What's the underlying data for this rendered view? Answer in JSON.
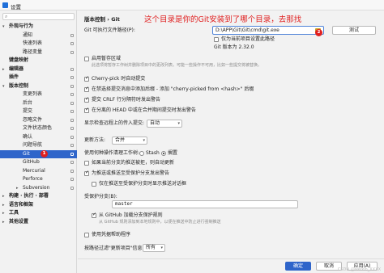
{
  "window": {
    "title": "设置"
  },
  "sidebar": {
    "items": [
      {
        "label": "外观与行为",
        "level": 0,
        "bold": true,
        "expanded": true
      },
      {
        "label": "通知",
        "level": 1
      },
      {
        "label": "快速列表",
        "level": 1
      },
      {
        "label": "路径变量",
        "level": 1
      },
      {
        "label": "键盘映射",
        "level": 0,
        "bold": true
      },
      {
        "label": "编辑器",
        "level": 0,
        "bold": true,
        "collapsed": true
      },
      {
        "label": "插件",
        "level": 0,
        "bold": true
      },
      {
        "label": "版本控制",
        "level": 0,
        "bold": true,
        "expanded": true
      },
      {
        "label": "变更列表",
        "level": 1
      },
      {
        "label": "后台",
        "level": 1
      },
      {
        "label": "提交",
        "level": 1
      },
      {
        "label": "忽略文件",
        "level": 1
      },
      {
        "label": "文件状态颜色",
        "level": 1
      },
      {
        "label": "确认",
        "level": 1
      },
      {
        "label": "问题导航",
        "level": 1
      },
      {
        "label": "Git",
        "level": 1,
        "selected": true
      },
      {
        "label": "GitHub",
        "level": 1
      },
      {
        "label": "Mercurial",
        "level": 1
      },
      {
        "label": "Perforce",
        "level": 1
      },
      {
        "label": "Subversion",
        "level": 1,
        "collapsed": true
      },
      {
        "label": "构建 · 执行 · 部署",
        "level": 0,
        "bold": true,
        "collapsed": true
      },
      {
        "label": "语言和框架",
        "level": 0,
        "bold": true,
        "collapsed": true
      },
      {
        "label": "工具",
        "level": 0,
        "bold": true,
        "collapsed": true
      },
      {
        "label": "其他设置",
        "level": 0,
        "bold": true,
        "collapsed": true
      }
    ],
    "badge_git": "1",
    "help": "?"
  },
  "main": {
    "breadcrumb": "版本控制 › Git",
    "annotation": "这个目录是你的Git安装到了哪个目录，去那找",
    "badge_path": "2",
    "git_path_label": "Git 可执行文件路径(P):",
    "git_path_value": "D:\\APP\\Git\\Git\\cmd\\git.exe",
    "test_button": "测试",
    "only_project_label": "仅为当前项目设置此路径",
    "git_version": "Git 版本为 2.32.0",
    "staging_label": "启用暂存区域",
    "staging_desc": "此选项将暂存工作树并删除项目中的更改列表。可能一些操作不可用，比如一些提交将被替换。",
    "cherry_pick_label": "Cherry-pick 时自动提交",
    "cherry_pick_msg_label": "在禁选择提交消息中添加后缀 - 添加 \"cherry-picked from <hash>\" 后缀",
    "crlf_label": "提交 CRLF 行分隔符时发出警告",
    "detached_label": "在分离的 HEAD 中或在合并期间提交时发出警告",
    "incoming_label": "显示检查远程上的传入提交:",
    "incoming_value": "自动",
    "update_method_label": "更新方法:",
    "update_method_value": "合并",
    "clean_tree_label": "使用何种操作清理工作树:",
    "stash_label": "Stash",
    "shelve_label": "搁置",
    "auto_update_label": "如果当前分支的推送被拒，则自动更新",
    "warn_protected_label": "为推送或推送至受保护分支发出警告",
    "allow_force_label": "仅在推送至受保护分支时显示推送对话框",
    "protected_label": "受保护分支(B):",
    "protected_value": "master",
    "github_sync_label": "从 GitHub 加载分支保护规则",
    "github_sync_desc": "从 GitHub 规则添加到本地规则中，以便在推送中防止进行强制推送",
    "credential_label": "使用凭据帮助程序",
    "filter_label": "按路径过滤\"更新项目\"信息:",
    "filter_value": "所有"
  },
  "footer": {
    "ok": "确定",
    "cancel": "取消",
    "apply": "应用(A)",
    "watermark": "CSDN @weixin_XXXX"
  }
}
